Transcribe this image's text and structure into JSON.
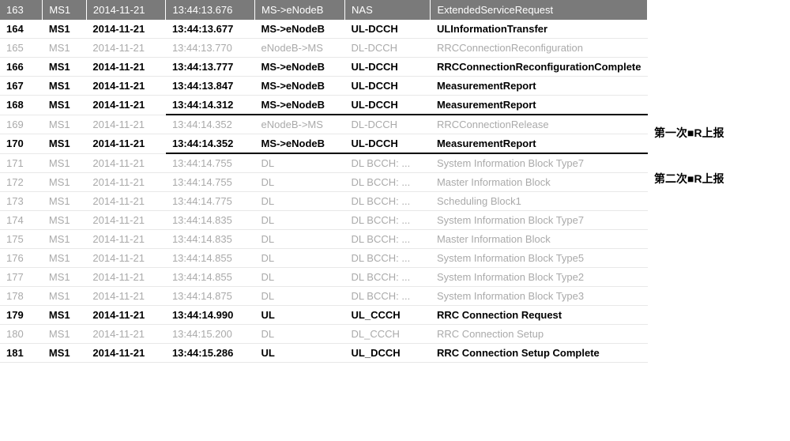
{
  "header": {
    "idx": "163",
    "ms": "MS1",
    "date": "2014-11-21",
    "time": "13:44:13.676",
    "dir": "MS->eNodeB",
    "ch": "NAS",
    "msg": "ExtendedServiceRequest"
  },
  "rows": [
    {
      "idx": "164",
      "ms": "MS1",
      "date": "2014-11-21",
      "time": "13:44:13.677",
      "dir": "MS->eNodeB",
      "ch": "UL-DCCH",
      "msg": "ULInformationTransfer",
      "style": "bold",
      "underline": false
    },
    {
      "idx": "165",
      "ms": "MS1",
      "date": "2014-11-21",
      "time": "13:44:13.770",
      "dir": "eNodeB->MS",
      "ch": "DL-DCCH",
      "msg": "RRCConnectionReconfiguration",
      "style": "gray",
      "underline": false
    },
    {
      "idx": "166",
      "ms": "MS1",
      "date": "2014-11-21",
      "time": "13:44:13.777",
      "dir": "MS->eNodeB",
      "ch": "UL-DCCH",
      "msg": "RRCConnectionReconfigurationComplete",
      "style": "bold",
      "underline": false
    },
    {
      "idx": "167",
      "ms": "MS1",
      "date": "2014-11-21",
      "time": "13:44:13.847",
      "dir": "MS->eNodeB",
      "ch": "UL-DCCH",
      "msg": "MeasurementReport",
      "style": "bold",
      "underline": false
    },
    {
      "idx": "168",
      "ms": "MS1",
      "date": "2014-11-21",
      "time": "13:44:14.312",
      "dir": "MS->eNodeB",
      "ch": "UL-DCCH",
      "msg": "MeasurementReport",
      "style": "bold",
      "underline": true
    },
    {
      "idx": "169",
      "ms": "MS1",
      "date": "2014-11-21",
      "time": "13:44:14.352",
      "dir": "eNodeB->MS",
      "ch": "DL-DCCH",
      "msg": "RRCConnectionRelease",
      "style": "gray",
      "underline": false
    },
    {
      "idx": "170",
      "ms": "MS1",
      "date": "2014-11-21",
      "time": "13:44:14.352",
      "dir": "MS->eNodeB",
      "ch": "UL-DCCH",
      "msg": "MeasurementReport",
      "style": "bold",
      "underline": true
    },
    {
      "idx": "171",
      "ms": "MS1",
      "date": "2014-11-21",
      "time": "13:44:14.755",
      "dir": "DL",
      "ch": "DL BCCH: ...",
      "msg": "System Information Block Type7",
      "style": "gray",
      "underline": false
    },
    {
      "idx": "172",
      "ms": "MS1",
      "date": "2014-11-21",
      "time": "13:44:14.755",
      "dir": "DL",
      "ch": "DL BCCH: ...",
      "msg": "Master Information Block",
      "style": "gray",
      "underline": false
    },
    {
      "idx": "173",
      "ms": "MS1",
      "date": "2014-11-21",
      "time": "13:44:14.775",
      "dir": "DL",
      "ch": "DL BCCH: ...",
      "msg": "Scheduling Block1",
      "style": "gray",
      "underline": false
    },
    {
      "idx": "174",
      "ms": "MS1",
      "date": "2014-11-21",
      "time": "13:44:14.835",
      "dir": "DL",
      "ch": "DL BCCH: ...",
      "msg": "System Information Block Type7",
      "style": "gray",
      "underline": false
    },
    {
      "idx": "175",
      "ms": "MS1",
      "date": "2014-11-21",
      "time": "13:44:14.835",
      "dir": "DL",
      "ch": "DL BCCH: ...",
      "msg": "Master Information Block",
      "style": "gray",
      "underline": false
    },
    {
      "idx": "176",
      "ms": "MS1",
      "date": "2014-11-21",
      "time": "13:44:14.855",
      "dir": "DL",
      "ch": "DL BCCH: ...",
      "msg": "System Information Block Type5",
      "style": "gray",
      "underline": false
    },
    {
      "idx": "177",
      "ms": "MS1",
      "date": "2014-11-21",
      "time": "13:44:14.855",
      "dir": "DL",
      "ch": "DL BCCH: ...",
      "msg": "System Information Block Type2",
      "style": "gray",
      "underline": false
    },
    {
      "idx": "178",
      "ms": "MS1",
      "date": "2014-11-21",
      "time": "13:44:14.875",
      "dir": "DL",
      "ch": "DL BCCH: ...",
      "msg": "System Information Block Type3",
      "style": "gray",
      "underline": false
    },
    {
      "idx": "179",
      "ms": "MS1",
      "date": "2014-11-21",
      "time": "13:44:14.990",
      "dir": "UL",
      "ch": "UL_CCCH",
      "msg": "RRC Connection Request",
      "style": "bold",
      "underline": false
    },
    {
      "idx": "180",
      "ms": "MS1",
      "date": "2014-11-21",
      "time": "13:44:15.200",
      "dir": "DL",
      "ch": "DL_CCCH",
      "msg": "RRC Connection Setup",
      "style": "gray",
      "underline": false
    },
    {
      "idx": "181",
      "ms": "MS1",
      "date": "2014-11-21",
      "time": "13:44:15.286",
      "dir": "UL",
      "ch": "UL_DCCH",
      "msg": "RRC Connection Setup Complete",
      "style": "bold",
      "underline": false
    }
  ],
  "annotations": {
    "a1": "第一次■R上报",
    "a2": "第二次■R上报"
  }
}
